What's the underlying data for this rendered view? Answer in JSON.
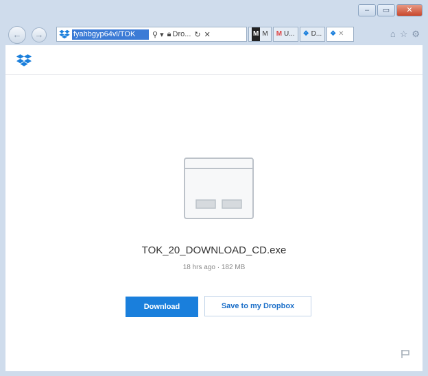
{
  "browser": {
    "address": {
      "url_text": "fyahbgyp64vl/TOK",
      "search_symbol": "⚲ ▾",
      "domain_text": "Dro...",
      "refresh_symbol": "↻",
      "close_symbol": "✕"
    },
    "tabs": [
      {
        "icon": "M",
        "label": "M",
        "icon_color": "#222"
      },
      {
        "icon": "M",
        "label": "U...",
        "icon_color": "#d44"
      },
      {
        "icon": "❖",
        "label": "D...",
        "icon_color": "#1a7fdc"
      },
      {
        "icon": "❖",
        "label": "✕",
        "icon_color": "#1a7fdc",
        "active": true
      }
    ],
    "window_controls": {
      "minimize": "–",
      "maximize": "▭",
      "close": "✕"
    }
  },
  "file": {
    "name": "TOK_20_DOWNLOAD_CD.exe",
    "meta": "18 hrs ago · 182 MB"
  },
  "actions": {
    "download_label": "Download",
    "save_label": "Save to my Dropbox"
  },
  "colors": {
    "accent": "#1a7fdc",
    "link": "#1a6ec8"
  }
}
